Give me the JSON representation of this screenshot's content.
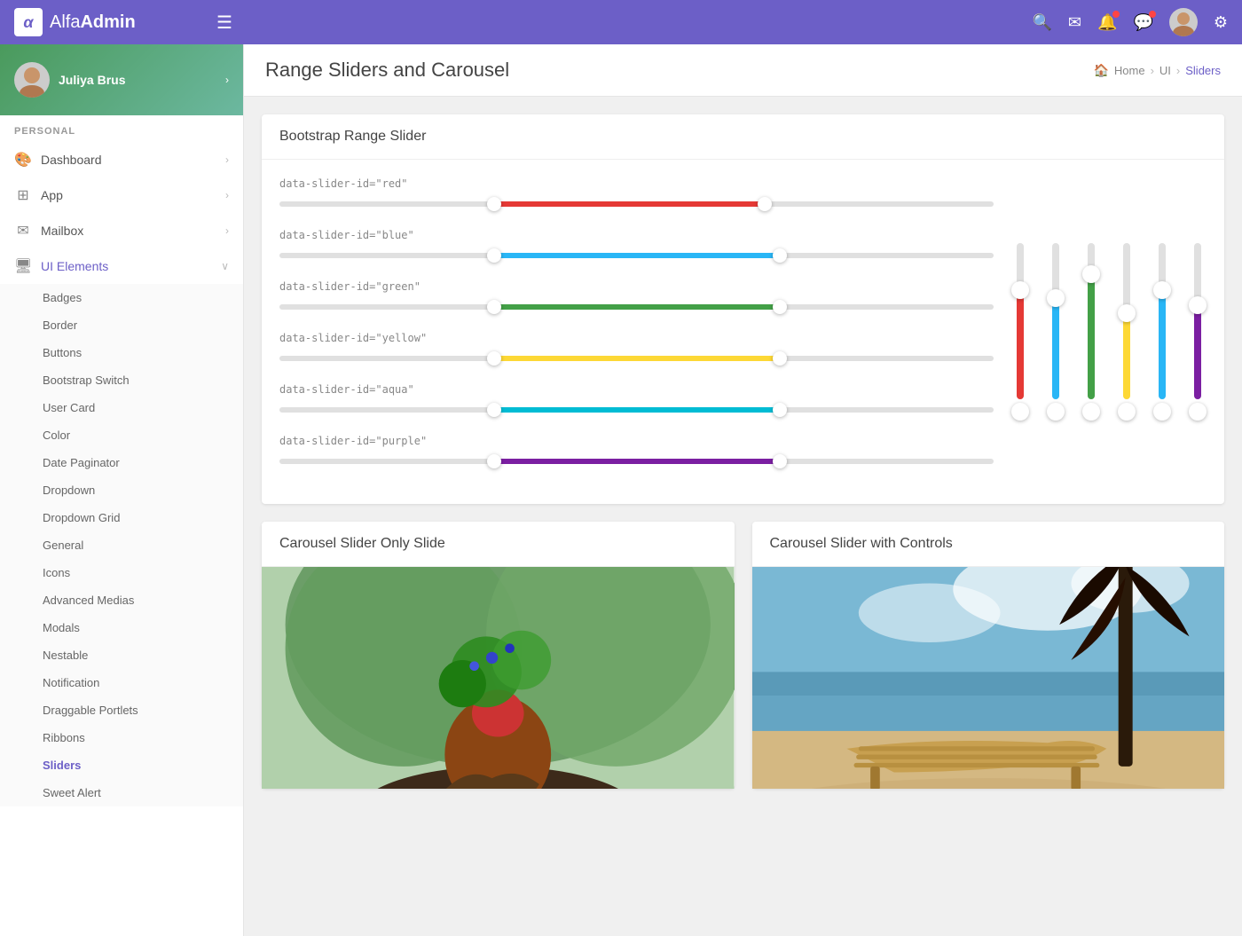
{
  "app": {
    "brand_alfa": "Alfa",
    "brand_admin": "Admin"
  },
  "topnav": {
    "hamburger": "☰",
    "icons": [
      "🔍",
      "✉",
      "🔔",
      "💬",
      "⚙"
    ]
  },
  "sidebar": {
    "user": {
      "name": "Juliya Brus",
      "arrow": "›"
    },
    "section_label": "PERSONAL",
    "items": [
      {
        "label": "Dashboard",
        "icon": "🎨",
        "arrow": "›",
        "has_sub": false
      },
      {
        "label": "App",
        "icon": "⊞",
        "arrow": "›",
        "has_sub": false
      },
      {
        "label": "Mailbox",
        "icon": "✉",
        "arrow": "›",
        "has_sub": false
      },
      {
        "label": "UI Elements",
        "icon": "🖥",
        "arrow": "∨",
        "has_sub": true
      }
    ],
    "subitems": [
      "Badges",
      "Border",
      "Buttons",
      "Bootstrap Switch",
      "User Card",
      "Color",
      "Date Paginator",
      "Dropdown",
      "Dropdown Grid",
      "General",
      "Icons",
      "Advanced Medias",
      "Modals",
      "Nestable",
      "Notification",
      "Draggable Portlets",
      "Ribbons",
      "Sliders",
      "Sweet Alert"
    ]
  },
  "page": {
    "title": "Range Sliders and Carousel",
    "breadcrumb": {
      "home": "Home",
      "ui": "UI",
      "current": "Sliders"
    }
  },
  "bootstrap_range_slider": {
    "title": "Bootstrap Range Slider",
    "sliders": [
      {
        "label": "data-slider-id=\"red\"",
        "color": "#e53935",
        "fill_left": "30%",
        "fill_width": "38%",
        "handle_left_pos": "30%",
        "handle_right_pos": "68%"
      },
      {
        "label": "data-slider-id=\"blue\"",
        "color": "#29b6f6",
        "fill_left": "30%",
        "fill_width": "40%",
        "handle_left_pos": "30%",
        "handle_right_pos": "70%"
      },
      {
        "label": "data-slider-id=\"green\"",
        "color": "#43a047",
        "fill_left": "30%",
        "fill_width": "40%",
        "handle_left_pos": "30%",
        "handle_right_pos": "70%"
      },
      {
        "label": "data-slider-id=\"yellow\"",
        "color": "#fdd835",
        "fill_left": "30%",
        "fill_width": "40%",
        "handle_left_pos": "30%",
        "handle_right_pos": "70%"
      },
      {
        "label": "data-slider-id=\"aqua\"",
        "color": "#00bcd4",
        "fill_left": "30%",
        "fill_width": "40%",
        "handle_left_pos": "30%",
        "handle_right_pos": "70%"
      },
      {
        "label": "data-slider-id=\"purple\"",
        "color": "#7b1fa2",
        "fill_left": "30%",
        "fill_width": "40%",
        "handle_left_pos": "30%",
        "handle_right_pos": "70%"
      }
    ],
    "vertical_sliders": [
      {
        "color": "#e53935",
        "fill_height": "70%"
      },
      {
        "color": "#29b6f6",
        "fill_height": "65%"
      },
      {
        "color": "#43a047",
        "fill_height": "80%"
      },
      {
        "color": "#fdd835",
        "fill_height": "55%"
      },
      {
        "color": "#29b6f6",
        "fill_height": "70%"
      },
      {
        "color": "#7b1fa2",
        "fill_height": "60%"
      }
    ]
  },
  "carousel_only": {
    "title": "Carousel Slider Only Slide"
  },
  "carousel_controls": {
    "title": "Carousel Slider with Controls"
  }
}
